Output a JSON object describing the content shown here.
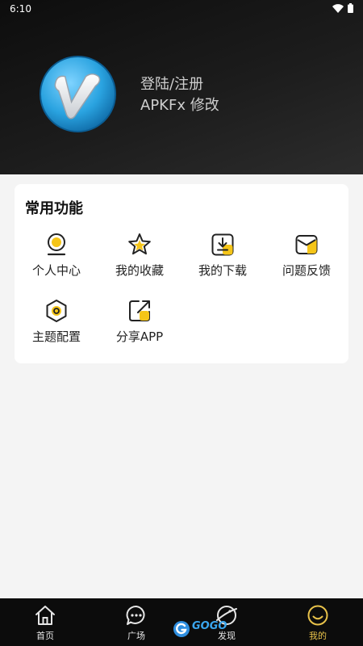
{
  "status_bar": {
    "time": "6:10"
  },
  "profile": {
    "line1": "登陆/注册",
    "line2": "APKFx 修改"
  },
  "features": {
    "title": "常用功能",
    "items": [
      {
        "label": "个人中心",
        "icon": "user-center-icon"
      },
      {
        "label": "我的收藏",
        "icon": "star-icon"
      },
      {
        "label": "我的下载",
        "icon": "download-icon"
      },
      {
        "label": "问题反馈",
        "icon": "mail-icon"
      },
      {
        "label": "主题配置",
        "icon": "hexagon-theme-icon"
      },
      {
        "label": "分享APP",
        "icon": "share-icon"
      }
    ]
  },
  "bottom_nav": {
    "items": [
      {
        "label": "首页",
        "icon": "home-icon"
      },
      {
        "label": "广场",
        "icon": "chat-bubble-icon"
      },
      {
        "label": "发现",
        "icon": "planet-icon"
      },
      {
        "label": "我的",
        "icon": "smiley-icon"
      }
    ],
    "active_index": 3
  },
  "watermark": {
    "text": "GOGO"
  },
  "colors": {
    "accent": "#f5c518",
    "header_bg": "#141414",
    "nav_bg": "#0c0c0c",
    "card_bg": "#ffffff",
    "page_bg": "#f4f4f4"
  }
}
